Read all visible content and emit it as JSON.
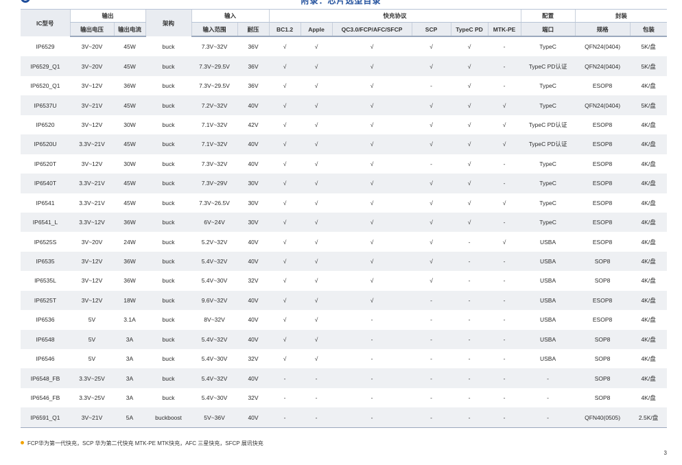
{
  "page": {
    "title": "附录：芯片选型目录",
    "page_number": "3"
  },
  "table": {
    "header": {
      "ic_model": "IC型号",
      "output": "输出",
      "output_voltage": "输出电压",
      "output_current": "输出电流",
      "architecture": "架构",
      "input": "输入",
      "input_range": "输入范围",
      "withstand_voltage": "耐压",
      "fast_charge": "快充协议",
      "bc12": "BC1.2",
      "apple": "Apple",
      "qc": "QC3.0/FCP/AFC/SFCP",
      "scp": "SCP",
      "typec_pd": "TypeC PD",
      "mtk_pe": "MTK-PE",
      "config": "配置",
      "port": "端口",
      "package": "封装",
      "spec": "规格",
      "packing": "包装"
    },
    "rows": [
      [
        "IP6529",
        "3V~20V",
        "45W",
        "buck",
        "7.3V~32V",
        "36V",
        "√",
        "√",
        "√",
        "√",
        "√",
        "-",
        "TypeC",
        "QFN24(0404)",
        "5K/盘"
      ],
      [
        "IP6529_Q1",
        "3V~20V",
        "45W",
        "buck",
        "7.3V~29.5V",
        "36V",
        "√",
        "√",
        "√",
        "√",
        "√",
        "-",
        "TypeC PD认证",
        "QFN24(0404)",
        "5K/盘"
      ],
      [
        "IP6520_Q1",
        "3V~12V",
        "36W",
        "buck",
        "7.3V~29.5V",
        "36V",
        "√",
        "√",
        "√",
        "-",
        "√",
        "-",
        "TypeC",
        "ESOP8",
        "4K/盘"
      ],
      [
        "IP6537U",
        "3V~21V",
        "45W",
        "buck",
        "7.2V~32V",
        "40V",
        "√",
        "√",
        "√",
        "√",
        "√",
        "√",
        "TypeC",
        "QFN24(0404)",
        "5K/盘"
      ],
      [
        "IP6520",
        "3V~12V",
        "30W",
        "buck",
        "7.1V~32V",
        "42V",
        "√",
        "√",
        "√",
        "√",
        "√",
        "√",
        "TypeC PD认证",
        "ESOP8",
        "4K/盘"
      ],
      [
        "IP6520U",
        "3.3V~21V",
        "45W",
        "buck",
        "7.1V~32V",
        "40V",
        "√",
        "√",
        "√",
        "√",
        "√",
        "√",
        "TypeC PD认证",
        "ESOP8",
        "4K/盘"
      ],
      [
        "IP6520T",
        "3V~12V",
        "30W",
        "buck",
        "7.3V~32V",
        "40V",
        "√",
        "√",
        "√",
        "-",
        "√",
        "-",
        "TypeC",
        "ESOP8",
        "4K/盘"
      ],
      [
        "IP6540T",
        "3.3V~21V",
        "45W",
        "buck",
        "7.3V~29V",
        "30V",
        "√",
        "√",
        "√",
        "√",
        "√",
        "-",
        "TypeC",
        "ESOP8",
        "4K/盘"
      ],
      [
        "IP6541",
        "3.3V~21V",
        "45W",
        "buck",
        "7.3V~26.5V",
        "30V",
        "√",
        "√",
        "√",
        "√",
        "√",
        "√",
        "TypeC",
        "ESOP8",
        "4K/盘"
      ],
      [
        "IP6541_L",
        "3.3V~12V",
        "36W",
        "buck",
        "6V~24V",
        "30V",
        "√",
        "√",
        "√",
        "√",
        "√",
        "-",
        "TypeC",
        "ESOP8",
        "4K/盘"
      ],
      [
        "IP6525S",
        "3V~20V",
        "24W",
        "buck",
        "5.2V~32V",
        "40V",
        "√",
        "√",
        "√",
        "√",
        "-",
        "√",
        "USBA",
        "ESOP8",
        "4K/盘"
      ],
      [
        "IP6535",
        "3V~12V",
        "36W",
        "buck",
        "5.4V~32V",
        "40V",
        "√",
        "√",
        "√",
        "√",
        "-",
        "-",
        "USBA",
        "SOP8",
        "4K/盘"
      ],
      [
        "IP6535L",
        "3V~12V",
        "36W",
        "buck",
        "5.4V~30V",
        "32V",
        "√",
        "√",
        "√",
        "√",
        "-",
        "-",
        "USBA",
        "SOP8",
        "4K/盘"
      ],
      [
        "IP6525T",
        "3V~12V",
        "18W",
        "buck",
        "9.6V~32V",
        "40V",
        "√",
        "√",
        "√",
        "-",
        "-",
        "-",
        "USBA",
        "ESOP8",
        "4K/盘"
      ],
      [
        "IP6536",
        "5V",
        "3.1A",
        "buck",
        "8V~32V",
        "40V",
        "√",
        "√",
        "-",
        "-",
        "-",
        "-",
        "USBA",
        "ESOP8",
        "4K/盘"
      ],
      [
        "IP6548",
        "5V",
        "3A",
        "buck",
        "5.4V~32V",
        "40V",
        "√",
        "√",
        "-",
        "-",
        "-",
        "-",
        "USBA",
        "SOP8",
        "4K/盘"
      ],
      [
        "IP6546",
        "5V",
        "3A",
        "buck",
        "5.4V~30V",
        "32V",
        "√",
        "√",
        "-",
        "-",
        "-",
        "-",
        "USBA",
        "SOP8",
        "4K/盘"
      ],
      [
        "IP6548_FB",
        "3.3V~25V",
        "3A",
        "buck",
        "5.4V~32V",
        "40V",
        "-",
        "-",
        "-",
        "-",
        "-",
        "-",
        "-",
        "SOP8",
        "4K/盘"
      ],
      [
        "IP6546_FB",
        "3.3V~25V",
        "3A",
        "buck",
        "5.4V~30V",
        "32V",
        "-",
        "-",
        "-",
        "-",
        "-",
        "-",
        "-",
        "SOP8",
        "4K/盘"
      ],
      [
        "IP6591_Q1",
        "3V~21V",
        "5A",
        "buckboost",
        "5V~36V",
        "40V",
        "-",
        "-",
        "-",
        "-",
        "-",
        "-",
        "-",
        "QFN40(0505)",
        "2.5K/盘"
      ]
    ]
  },
  "footnote": "FCP华为第一代快充，SCP 华为第二代快充 MTK-PE MTK快充，AFC 三星快充，SFCP 展讯快充",
  "colors": {
    "brand_blue": "#1f4e9c",
    "header_gray": "#e9ecf1",
    "row_stripe": "#eef0f3",
    "bullet_orange": "#f2a300"
  }
}
